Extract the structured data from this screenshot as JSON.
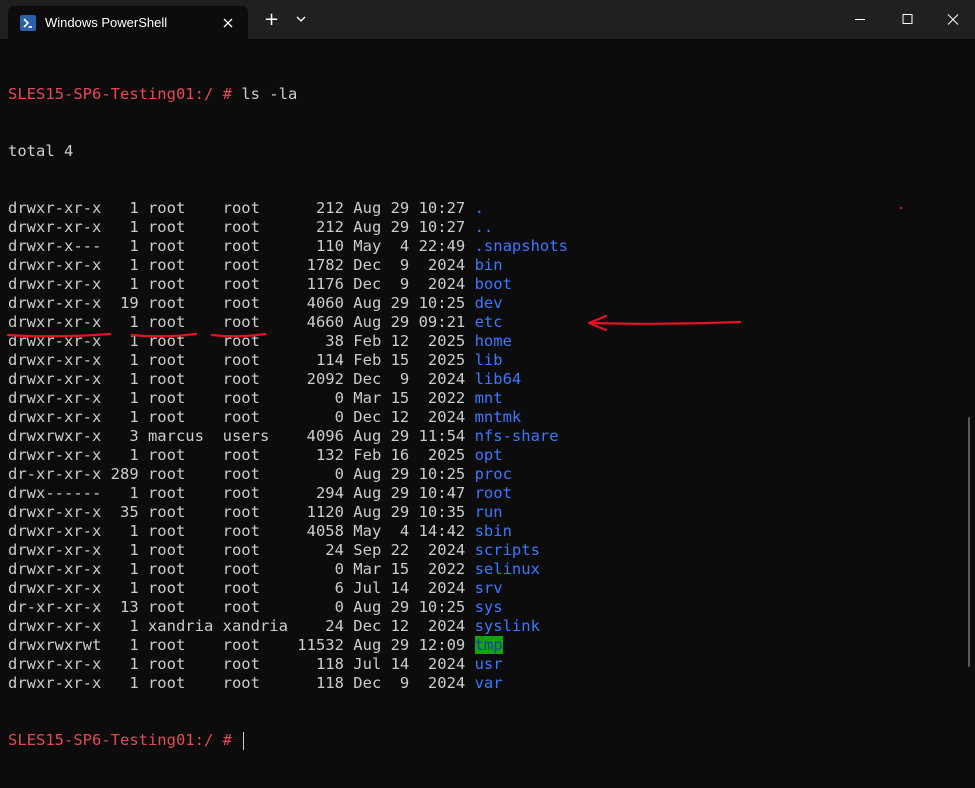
{
  "window": {
    "tab_title": "Windows PowerShell",
    "new_tab_symbol": "+",
    "colors": {
      "prompt": "#e74856",
      "dir": "#3b78ff",
      "highlight_bg": "#13a10e",
      "annotation": "#e81123"
    }
  },
  "terminal": {
    "prompt": "SLES15-SP6-Testing01:/ #",
    "command": "ls -la",
    "total": "total 4",
    "entries": [
      {
        "meta": "drwxr-xr-x   1 root    root      212 Aug 29 10:27 ",
        "name": "."
      },
      {
        "meta": "drwxr-xr-x   1 root    root      212 Aug 29 10:27 ",
        "name": ".."
      },
      {
        "meta": "drwxr-x---   1 root    root      110 May  4 22:49 ",
        "name": ".snapshots"
      },
      {
        "meta": "drwxr-xr-x   1 root    root     1782 Dec  9  2024 ",
        "name": "bin"
      },
      {
        "meta": "drwxr-xr-x   1 root    root     1176 Dec  9  2024 ",
        "name": "boot"
      },
      {
        "meta": "drwxr-xr-x  19 root    root     4060 Aug 29 10:25 ",
        "name": "dev"
      },
      {
        "meta": "drwxr-xr-x   1 root    root     4660 Aug 29 09:21 ",
        "name": "etc"
      },
      {
        "meta": "drwxr-xr-x   1 root    root       38 Feb 12  2025 ",
        "name": "home"
      },
      {
        "meta": "drwxr-xr-x   1 root    root      114 Feb 15  2025 ",
        "name": "lib"
      },
      {
        "meta": "drwxr-xr-x   1 root    root     2092 Dec  9  2024 ",
        "name": "lib64"
      },
      {
        "meta": "drwxr-xr-x   1 root    root        0 Mar 15  2022 ",
        "name": "mnt"
      },
      {
        "meta": "drwxr-xr-x   1 root    root        0 Dec 12  2024 ",
        "name": "mntmk"
      },
      {
        "meta": "drwxrwxr-x   3 marcus  users    4096 Aug 29 11:54 ",
        "name": "nfs-share"
      },
      {
        "meta": "drwxr-xr-x   1 root    root      132 Feb 16  2025 ",
        "name": "opt"
      },
      {
        "meta": "dr-xr-xr-x 289 root    root        0 Aug 29 10:25 ",
        "name": "proc"
      },
      {
        "meta": "drwx------   1 root    root      294 Aug 29 10:47 ",
        "name": "root"
      },
      {
        "meta": "drwxr-xr-x  35 root    root     1120 Aug 29 10:35 ",
        "name": "run"
      },
      {
        "meta": "drwxr-xr-x   1 root    root     4058 May  4 14:42 ",
        "name": "sbin"
      },
      {
        "meta": "drwxr-xr-x   1 root    root       24 Sep 22  2024 ",
        "name": "scripts"
      },
      {
        "meta": "drwxr-xr-x   1 root    root        0 Mar 15  2022 ",
        "name": "selinux"
      },
      {
        "meta": "drwxr-xr-x   1 root    root        6 Jul 14  2024 ",
        "name": "srv"
      },
      {
        "meta": "dr-xr-xr-x  13 root    root        0 Aug 29 10:25 ",
        "name": "sys"
      },
      {
        "meta": "drwxr-xr-x   1 xandria xandria    24 Dec 12  2024 ",
        "name": "syslink"
      },
      {
        "meta": "drwxrwxrwt   1 root    root    11532 Aug 29 12:09 ",
        "name": "tmp",
        "highlight": true
      },
      {
        "meta": "drwxr-xr-x   1 root    root      118 Jul 14  2024 ",
        "name": "usr"
      },
      {
        "meta": "drwxr-xr-x   1 root    root      118 Dec  9  2024 ",
        "name": "var"
      }
    ]
  }
}
